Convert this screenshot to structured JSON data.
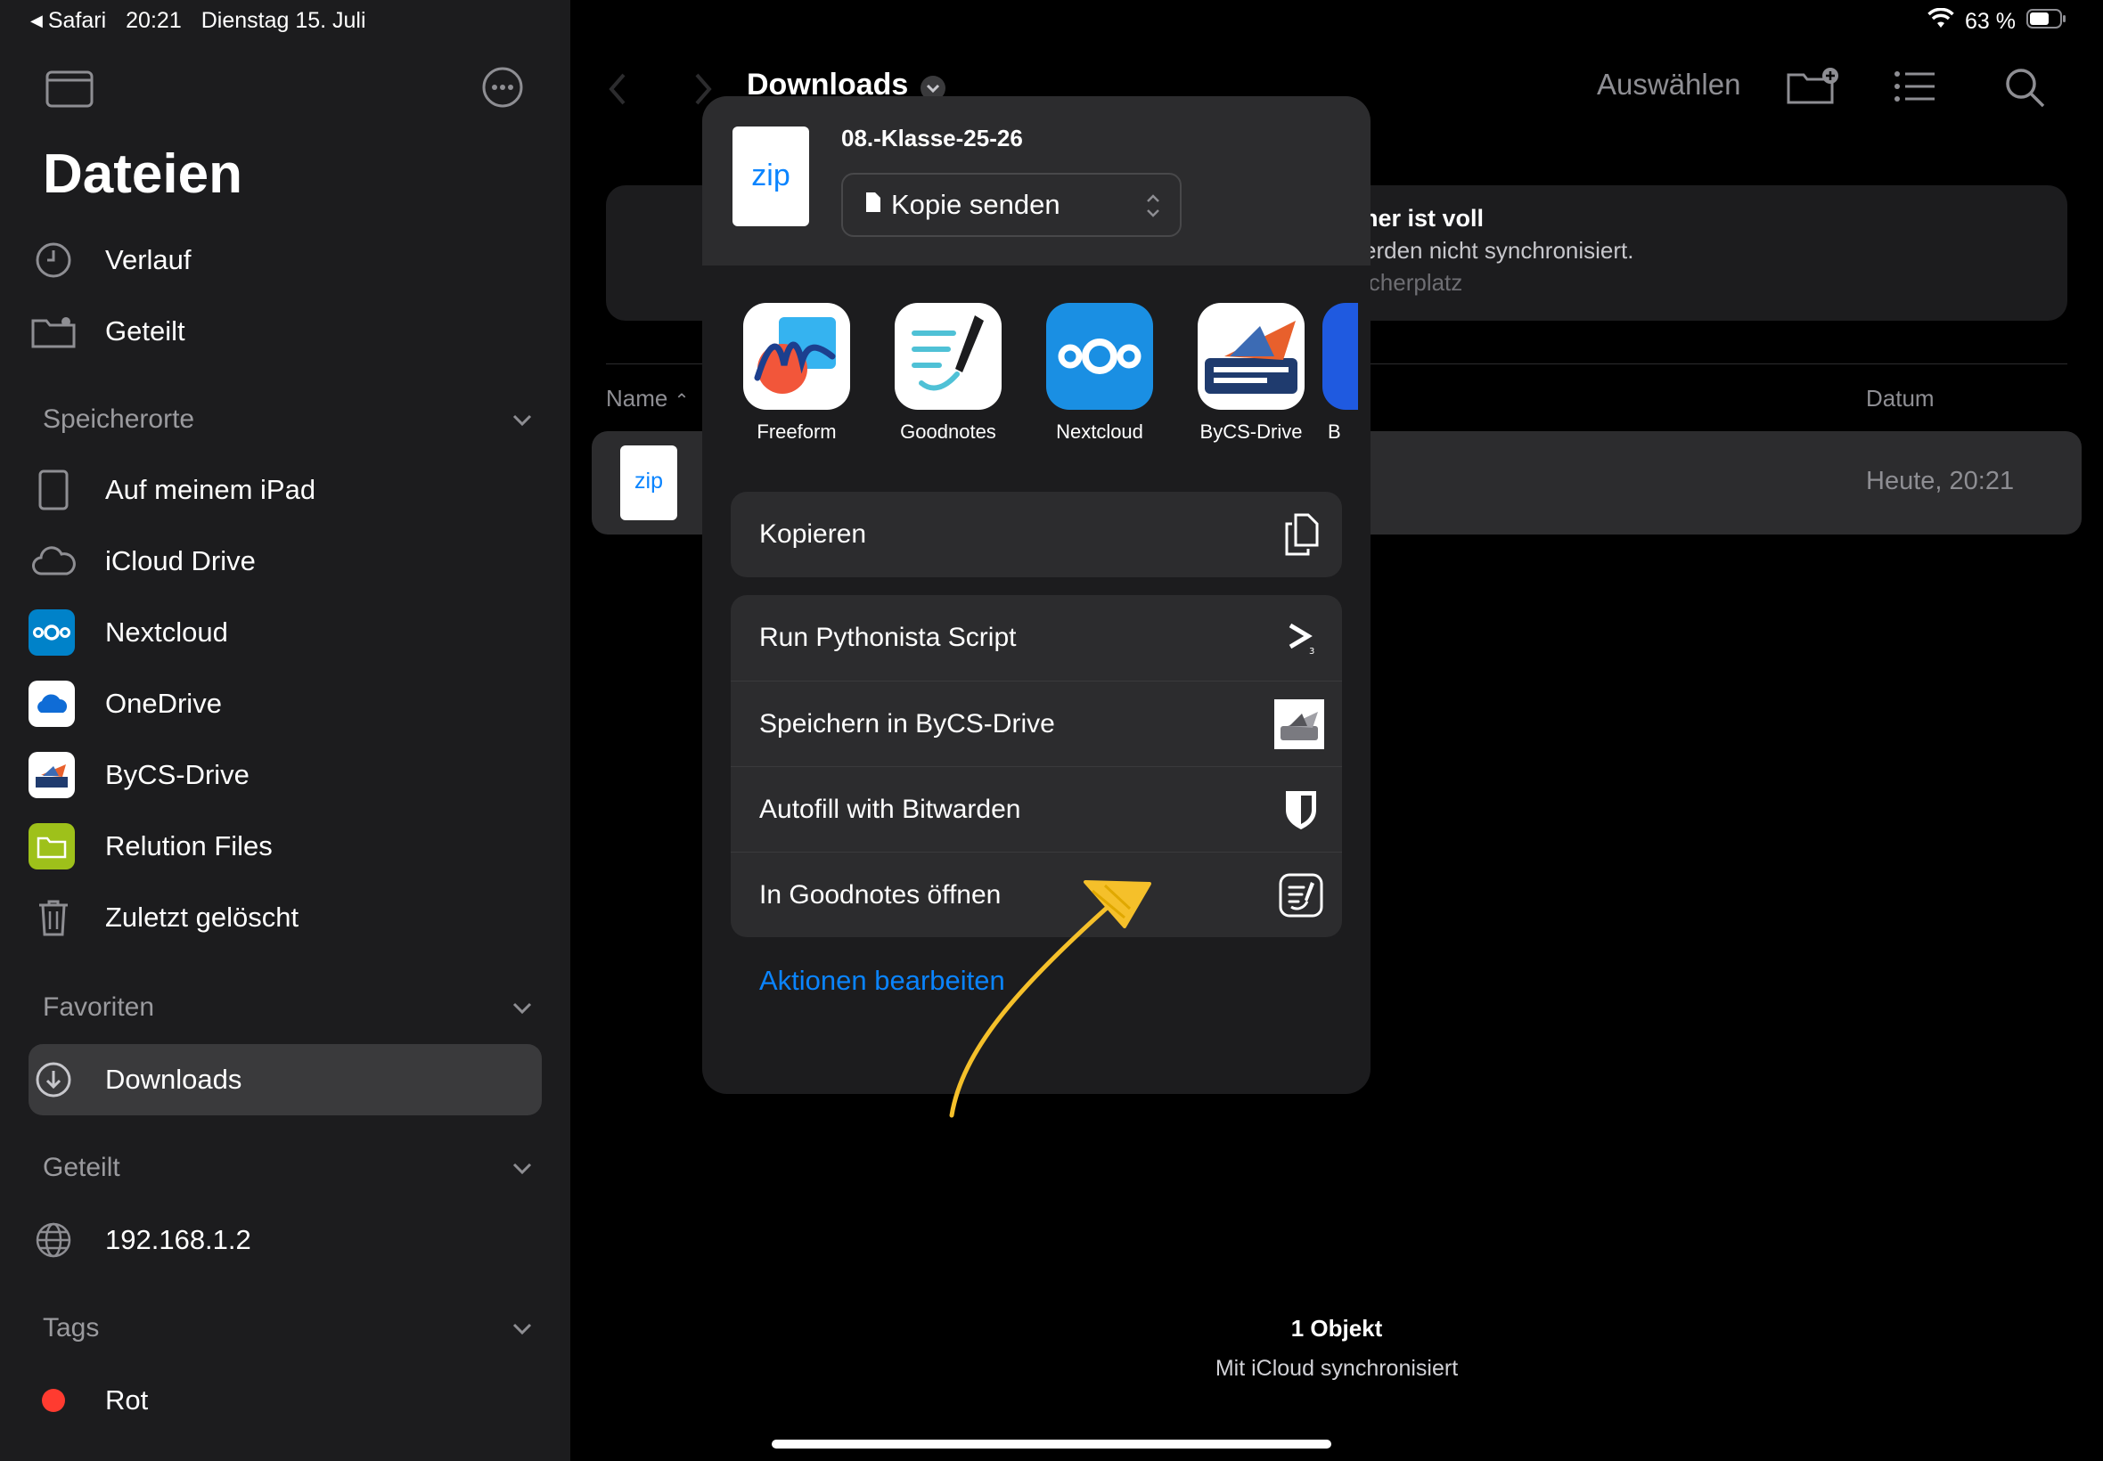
{
  "status_bar": {
    "back_app": "Safari",
    "time": "20:21",
    "date": "Dienstag 15. Juli",
    "battery": "63 %"
  },
  "sidebar": {
    "title": "Dateien",
    "recent": [
      {
        "label": "Verlauf",
        "icon": "clock-icon"
      },
      {
        "label": "Geteilt",
        "icon": "shared-folder-icon"
      }
    ],
    "locations_header": "Speicherorte",
    "locations": [
      {
        "label": "Auf meinem iPad",
        "icon": "ipad-icon"
      },
      {
        "label": "iCloud Drive",
        "icon": "cloud-icon"
      },
      {
        "label": "Nextcloud",
        "icon": "nextcloud-icon"
      },
      {
        "label": "OneDrive",
        "icon": "onedrive-icon"
      },
      {
        "label": "ByCS-Drive",
        "icon": "bycs-drive-icon"
      },
      {
        "label": "Relution Files",
        "icon": "relution-icon"
      },
      {
        "label": "Zuletzt gelöscht",
        "icon": "trash-icon"
      }
    ],
    "favorites_header": "Favoriten",
    "favorites": [
      {
        "label": "Downloads",
        "icon": "download-circle-icon",
        "selected": true
      }
    ],
    "shared_header": "Geteilt",
    "shared": [
      {
        "label": "192.168.1.2",
        "icon": "globe-icon"
      }
    ],
    "tags_header": "Tags",
    "tags": [
      {
        "label": "Rot",
        "color": "#ff3b30"
      }
    ]
  },
  "main": {
    "title": "Downloads",
    "select_label": "Auswählen",
    "banner": {
      "line1": "her ist voll",
      "line2": "erden nicht synchronisiert.",
      "line3": "icherplatz"
    },
    "columns": {
      "name": "Name",
      "date": "Datum"
    },
    "file": {
      "icon_text": "zip",
      "date": "Heute, 20:21"
    },
    "footer_count": "1 Objekt",
    "footer_sync": "Mit iCloud synchronisiert"
  },
  "share_sheet": {
    "file_icon_text": "zip",
    "file_name": "08.-Klasse-25-26",
    "send_mode": "Kopie senden",
    "apps": [
      {
        "label": "Freeform",
        "icon": "freeform-icon"
      },
      {
        "label": "Goodnotes",
        "icon": "goodnotes-icon"
      },
      {
        "label": "Nextcloud",
        "icon": "nextcloud-icon"
      },
      {
        "label": "ByCS-Drive",
        "icon": "bycs-drive-icon"
      },
      {
        "label": "B",
        "icon": "partial-app-icon"
      }
    ],
    "action_copy": "Kopieren",
    "actions": [
      {
        "label": "Run Pythonista Script",
        "icon": "pythonista-icon"
      },
      {
        "label": "Speichern in ByCS-Drive",
        "icon": "bycs-drive-icon"
      },
      {
        "label": "Autofill with Bitwarden",
        "icon": "bitwarden-shield-icon"
      },
      {
        "label": "In Goodnotes öffnen",
        "icon": "goodnotes-open-icon"
      }
    ],
    "edit_actions": "Aktionen bearbeiten"
  },
  "colors": {
    "accent": "#0a84ff",
    "annotation": "#f5c02a",
    "sidebar_bg": "#1c1c1e",
    "selected_bg": "#3a3a3c"
  }
}
